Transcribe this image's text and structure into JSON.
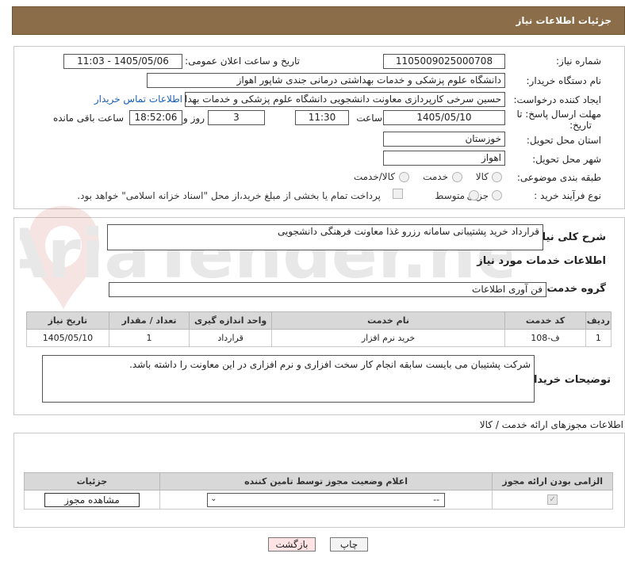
{
  "header": {
    "title": "جزئیات اطلاعات نیاز"
  },
  "form": {
    "need_number_label": "شماره نیاز:",
    "need_number": "1105009025000708",
    "announce_label": "تاریخ و ساعت اعلان عمومی:",
    "announce_value": "1405/05/06 - 11:03",
    "buyer_label": "نام دستگاه خریدار:",
    "buyer_value": "دانشگاه علوم پزشکی و خدمات بهداشتی درمانی جندی شاپور اهواز",
    "creator_label": "ایجاد کننده درخواست:",
    "creator_value": "حسین سرخی کارپردازی معاونت دانشجویی دانشگاه علوم پزشکی و خدمات بهداشتی درمانی جندی شاپور اهواز",
    "contact_link": "اطلاعات تماس خریدار",
    "deadline_label_1": "مهلت ارسال پاسخ: تا",
    "deadline_label_2": "تاریخ:",
    "deadline_date": "1405/05/10",
    "time_label": "ساعت",
    "deadline_time": "11:30",
    "days_value": "3",
    "days_label": "روز و",
    "remaining_time": "18:52:06",
    "remaining_label": "ساعت باقی مانده",
    "province_label": "استان محل تحویل:",
    "province_value": "خوزستان",
    "city_label": "شهر محل تحویل:",
    "city_value": "اهواز",
    "category_label": "طبقه بندی موضوعی:",
    "category_options": [
      "کالا",
      "خدمت",
      "کالا/خدمت"
    ],
    "process_label": "نوع فرآیند خرید :",
    "process_options": [
      "جزیی",
      "متوسط"
    ],
    "payment_note": "پرداخت تمام یا بخشی از مبلغ خرید،از محل \"اسناد خزانه اسلامی\" خواهد بود."
  },
  "summary": {
    "label": "شرح کلی نیاز:",
    "value": "قرارداد خرید پشتیبانی سامانه رزرو غذا معاونت فرهنگی دانشجویی"
  },
  "services": {
    "section_title": "اطلاعات خدمات مورد نیاز",
    "group_label": "گروه خدمت:",
    "group_value": "فن آوری اطلاعات",
    "table": {
      "headers": [
        "ردیف",
        "کد خدمت",
        "نام خدمت",
        "واحد اندازه گیری",
        "تعداد / مقدار",
        "تاریخ نیاز"
      ],
      "rows": [
        [
          "1",
          "ف-108",
          "خرید نرم افزار",
          "قرارداد",
          "1",
          "1405/05/10"
        ]
      ]
    },
    "buyer_notes_label": "توضیحات خریدار:",
    "buyer_notes": "شرکت پشتیبان می بایست سابقه انجام کار سخت افزاری و نرم افزاری در این معاونت را داشته باشد."
  },
  "permits": {
    "section_title": "اطلاعات مجوزهای ارائه خدمت / کالا",
    "headers": [
      "الزامی بودن ارائه مجوز",
      "اعلام وضعیت مجوز توسط تامین کننده",
      "جزئیات"
    ],
    "select_value": "--",
    "view_button": "مشاهده مجوز"
  },
  "footer": {
    "print_button": "چاپ",
    "back_button": "بازگشت"
  },
  "watermark": {
    "text": "AriaTender.neT"
  },
  "colors": {
    "header_bg": "#8b6d49",
    "link": "#1a5fb4",
    "back_button_bg": "#fde3e3"
  }
}
